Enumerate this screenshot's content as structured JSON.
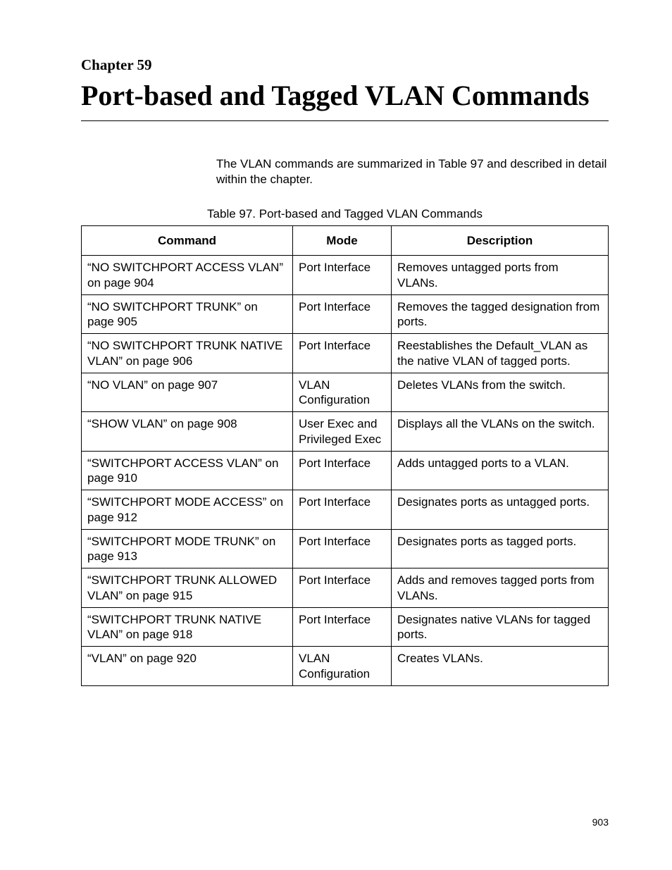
{
  "chapter": {
    "label": "Chapter 59",
    "title": "Port-based and Tagged VLAN Commands"
  },
  "intro": "The VLAN commands are summarized in Table 97 and described in detail within the chapter.",
  "table": {
    "caption": "Table 97. Port-based and Tagged VLAN Commands",
    "headers": {
      "command": "Command",
      "mode": "Mode",
      "description": "Description"
    },
    "rows": [
      {
        "command": "“NO SWITCHPORT ACCESS VLAN” on page 904",
        "mode": "Port Interface",
        "description": "Removes untagged ports from VLANs."
      },
      {
        "command": "“NO SWITCHPORT TRUNK” on page 905",
        "mode": "Port Interface",
        "description": "Removes the tagged designation from ports."
      },
      {
        "command": "“NO SWITCHPORT TRUNK NATIVE VLAN” on page 906",
        "mode": "Port Interface",
        "description": "Reestablishes the Default_VLAN as the native VLAN of tagged ports."
      },
      {
        "command": "“NO VLAN” on page 907",
        "mode": "VLAN Configuration",
        "description": "Deletes VLANs from the switch."
      },
      {
        "command": "“SHOW VLAN” on page 908",
        "mode": "User Exec and Privileged Exec",
        "description": "Displays all the VLANs on the switch."
      },
      {
        "command": "“SWITCHPORT ACCESS VLAN” on page 910",
        "mode": "Port Interface",
        "description": "Adds untagged ports to a VLAN."
      },
      {
        "command": "“SWITCHPORT MODE ACCESS” on page 912",
        "mode": "Port Interface",
        "description": "Designates ports as untagged ports."
      },
      {
        "command": "“SWITCHPORT MODE TRUNK” on page 913",
        "mode": "Port Interface",
        "description": "Designates ports as tagged ports."
      },
      {
        "command": "“SWITCHPORT TRUNK ALLOWED VLAN” on page 915",
        "mode": "Port Interface",
        "description": "Adds and removes tagged ports from VLANs."
      },
      {
        "command": "“SWITCHPORT TRUNK NATIVE VLAN” on page 918",
        "mode": "Port Interface",
        "description": "Designates native VLANs for tagged ports."
      },
      {
        "command": "“VLAN” on page 920",
        "mode": "VLAN Configuration",
        "description": "Creates VLANs."
      }
    ]
  },
  "page_number": "903"
}
